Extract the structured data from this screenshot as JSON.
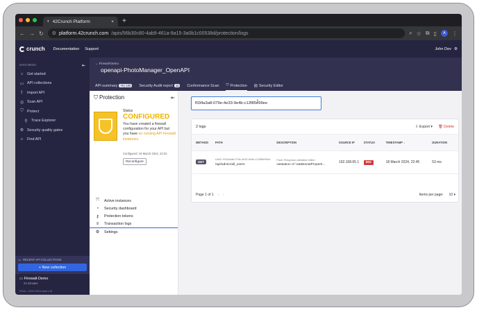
{
  "browser": {
    "tab_title": "42Crunch Platform",
    "tab_close": "×",
    "new_tab": "+",
    "url_host": "platform.42crunch.com",
    "url_path": "/apis/56b30c80-4ab9-461a-9a15-3a0b1c00538d/protection/logs",
    "profile_initial": "A",
    "traffic_colors": [
      "#ff5f57",
      "#febc2e",
      "#28c840"
    ]
  },
  "header": {
    "logo_text": "crunch",
    "links": [
      "Documentation",
      "Support"
    ],
    "user_name": "John Dev"
  },
  "sidebar": {
    "section_label": "MAIN MENU",
    "items": [
      {
        "label": "Get started",
        "icon": "home-icon",
        "glyph": "⌂"
      },
      {
        "label": "API collections",
        "icon": "folder-icon",
        "glyph": "▭"
      },
      {
        "label": "Import API",
        "icon": "import-icon",
        "glyph": "⇪"
      },
      {
        "label": "Scan API",
        "icon": "scan-icon",
        "glyph": "◎"
      },
      {
        "label": "Protect",
        "icon": "shield-icon",
        "glyph": "⛉"
      },
      {
        "label": "Trace Explorer",
        "icon": "trace-icon",
        "glyph": "⚲",
        "sub": true
      },
      {
        "label": "Security quality gates",
        "icon": "gate-icon",
        "glyph": "⚙"
      },
      {
        "label": "Find API",
        "icon": "find-icon",
        "glyph": "⌕"
      }
    ],
    "recent_label": "RECENT API COLLECTIONS",
    "new_collection": "+ New collection",
    "recent_name": "Firewall-Demo",
    "recent_time": "23 minutes",
    "copyright": "2016—2024 42Crunch Ltd"
  },
  "content": {
    "breadcrumb": "← Firewall-Demo",
    "title": "openapi-PhotoManager_OpenAPI",
    "tabs": [
      {
        "label": "API summary",
        "badge": "79 | 100"
      },
      {
        "label": "Security Audit report",
        "badge": "11"
      },
      {
        "label": "Conformance Scan",
        "badge": ""
      },
      {
        "label": "Protection",
        "badge": "",
        "active": true
      },
      {
        "label": "Security Editor",
        "badge": ""
      }
    ]
  },
  "protection": {
    "heading": "Protection",
    "status_label": "Status",
    "status_value": "CONFIGURED",
    "desc_main": "You have created a firewall configuration for your API but you have",
    "desc_warn": "no running API Firewall instances.",
    "configured_date": "Configured:  18 March 2024, 22:32",
    "reconfigure": "Reconfigure",
    "nav": [
      {
        "label": "Active instances",
        "icon": "instances-icon",
        "glyph": "⤧"
      },
      {
        "label": "Security dashboard",
        "icon": "dashboard-icon",
        "glyph": "◔"
      },
      {
        "label": "Protection tokens",
        "icon": "key-icon",
        "glyph": "⚷"
      },
      {
        "label": "Transaction logs",
        "icon": "list-icon",
        "glyph": "≡",
        "active": true
      },
      {
        "label": "Settings",
        "icon": "settings-icon",
        "glyph": "⚙"
      }
    ]
  },
  "logs": {
    "search_value": "f034a3a8-079e-4e33-9e4b-c12f85e99ee",
    "count": "2 logs",
    "export": "Export",
    "delete": "Delete",
    "columns": [
      "METHOD",
      "PATH",
      "DESCRIPTION",
      "SOURCE IP",
      "STATUS",
      "TIMESTAMP ↓",
      "DURATION"
    ],
    "rows": [
      {
        "method": "GET",
        "uuid": "UUID: f034a3a8-079e-4e33-9e4b-c12f85e99ee",
        "path": "/api/admin/all_users",
        "desc_label": "Fault: Response-validation failed",
        "desc": "validation of \"additionalProperti...",
        "source_ip": "192.168.65.1",
        "status": "502",
        "timestamp": "18 March 2024, 22:45",
        "duration": "53 ms"
      }
    ],
    "page_label": "Page 1 of 1",
    "items_per_page_label": "Items per page:",
    "items_per_page": "10"
  }
}
